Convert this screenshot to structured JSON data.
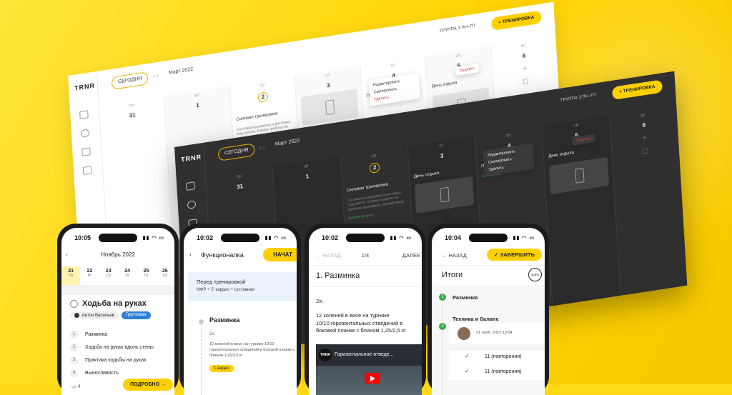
{
  "app": {
    "logo": "TRNR"
  },
  "light_calendar": {
    "today_label": "СЕГОДНЯ",
    "month": "Март 2022",
    "group": "ГРУППА 3 ПН–ПТ",
    "add_training": "+ ТРЕНИРОВКА",
    "days": [
      {
        "name": "ПН",
        "num": "31",
        "muted": true
      },
      {
        "name": "ВТ",
        "num": "1"
      },
      {
        "name": "СР",
        "num": "2",
        "today": true,
        "title": "Силовая тренировка",
        "sub": "Суставная разминка и растяжка под взятие. 5 минут работы на гребном тренажере (легкий темп)"
      },
      {
        "name": "ЧТ",
        "num": "3",
        "title": "",
        "rest": true
      },
      {
        "name": "ПТ",
        "num": "4",
        "title": "Плечевой пояс",
        "menu": true
      },
      {
        "name": "СБ",
        "num": "5",
        "title": "День отдыха",
        "delete": true
      },
      {
        "name": "ВС",
        "num": "6",
        "plus": true
      }
    ],
    "menu": {
      "edit": "Редактировать",
      "copy": "Скопировать",
      "delete": "Удалить"
    },
    "comments": "2",
    "rest_label": "День отдыха"
  },
  "dark_calendar": {
    "today_label": "СЕГОДНЯ",
    "month": "Март 2022",
    "group": "ГРУППА 3 ПН–ПТ",
    "add_training": "+ ТРЕНИРОВКА",
    "days": [
      {
        "name": "ПН",
        "num": "31"
      },
      {
        "name": "ВТ",
        "num": "1"
      },
      {
        "name": "СР",
        "num": "2",
        "today": true,
        "title": "Силовая тренировка",
        "sub": "Суставная разминка и растяжка под взятие. 5 минут работы на гребном тренажере (легкий темп)",
        "item": "Взятие штанги"
      },
      {
        "name": "ЧТ",
        "num": "3",
        "title": "День отдыха",
        "rest": true
      },
      {
        "name": "ПТ",
        "num": "4",
        "title": "Плечевой пояс",
        "menu": true,
        "item": "Гимнастика"
      },
      {
        "name": "СБ",
        "num": "5",
        "title": "День отдыха",
        "delete": true
      },
      {
        "name": "ВС",
        "num": "6",
        "plus": true
      }
    ],
    "menu": {
      "edit": "Редактировать",
      "copy": "Скопировать",
      "delete": "Удалить"
    },
    "comments": "2"
  },
  "phone1": {
    "time": "10:05",
    "month": "Ноябрь 2022",
    "week": [
      {
        "num": "21",
        "name": "Пн",
        "active": true
      },
      {
        "num": "22",
        "name": "Вт"
      },
      {
        "num": "23",
        "name": "Ср"
      },
      {
        "num": "24",
        "name": "Чт"
      },
      {
        "num": "25",
        "name": "Пт"
      },
      {
        "num": "26",
        "name": "Сб"
      }
    ],
    "title": "Ходьба на руках",
    "coach": "Антон Васильев",
    "type": "Групповая",
    "steps": [
      "Разминка",
      "Ходьба на руках вдоль стены",
      "Практика ходьбы на руках",
      "Выносливость"
    ],
    "comments": "4",
    "more": "ПОДРОБНО →"
  },
  "phone2": {
    "time": "10:02",
    "title": "Функционалка",
    "start": "НАЧАТ",
    "pre_title": "Перед тренировкой",
    "pre_sub": "МФР + 5' кардио + суставная",
    "section": "Разминка",
    "reps": "2x:",
    "text": "12 коленей в висе на турнике 10/10 горизонтальных отведений в боковой планке с блином 1,25/2,5 кг",
    "video": "1 видео"
  },
  "phone3": {
    "time": "10:02",
    "back": "НАЗАД",
    "progress": "1/4",
    "next": "ДАЛЕЕ",
    "title": "1. Разминка",
    "reps": "2x:",
    "line1": "12 коленей в висе на турнике",
    "line2": "10/10 горизонтальных отведений в боковой планке с блином 1,25/2,5 кг",
    "video_title": "Горизонтальное отведе..."
  },
  "phone4": {
    "time": "10:04",
    "back": "НАЗАД",
    "finish": "✓ ЗАВЕРШИТЬ",
    "title": "Итоги",
    "percent": "100%",
    "s1": "Разминка",
    "s2": "Техника и баланс",
    "date": "21 нояб. 2022 10:04",
    "r1": "11 (повторения)",
    "r2": "11 (повторения)"
  },
  "colors": {
    "accent": "#FFD000",
    "bg": "#FFD915",
    "dark": "#2f2f2f",
    "green": "#3AAA4B",
    "red": "#E23D3D"
  }
}
